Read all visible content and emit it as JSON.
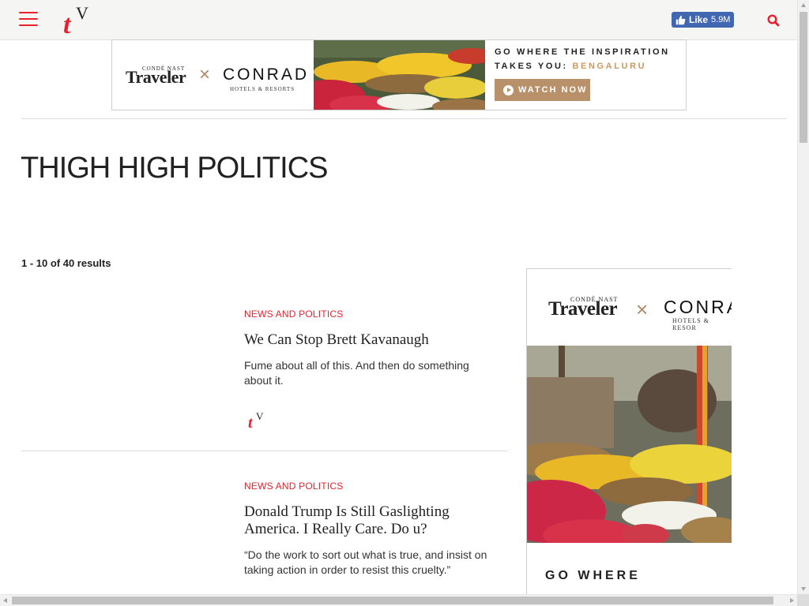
{
  "header": {
    "menu_icon": "hamburger-menu-icon",
    "logo_text": "tV",
    "facebook": {
      "like_label": "Like",
      "like_count": "5.9M"
    },
    "search_icon": "search-icon"
  },
  "top_banner": {
    "brand_small": "CONDÉ NAST",
    "brand_name": "Traveler",
    "partner_name": "CONRAD",
    "partner_sub": "HOTELS & RESORTS",
    "cta_line1": "GO WHERE THE INSPIRATION",
    "cta_line2_prefix": "TAKES YOU: ",
    "cta_line2_city": "BENGALURU",
    "watch_label": "WATCH NOW"
  },
  "page": {
    "title": "THIGH HIGH POLITICS",
    "results": "1 - 10 of 40 results"
  },
  "articles": [
    {
      "category": "NEWS AND POLITICS",
      "headline": "We Can Stop Brett Kavanaugh",
      "dek": "Fume about all of this. And then do something about it."
    },
    {
      "category": "NEWS AND POLITICS",
      "headline": "Donald Trump Is Still Gaslighting America. I Really Care. Do u?",
      "dek": "“Do the work to sort out what is true, and insist on taking action in order to resist this cruelty.”"
    }
  ],
  "side_ad": {
    "brand_small": "CONDÉ NAST",
    "brand_name": "Traveler",
    "partner_name": "CONRA",
    "partner_sub": "HOTELS & RESOR",
    "headline": "GO WHERE"
  },
  "colors": {
    "accent_red": "#e8212d",
    "facebook_blue": "#4267b2",
    "ad_gold": "#b8906a"
  }
}
